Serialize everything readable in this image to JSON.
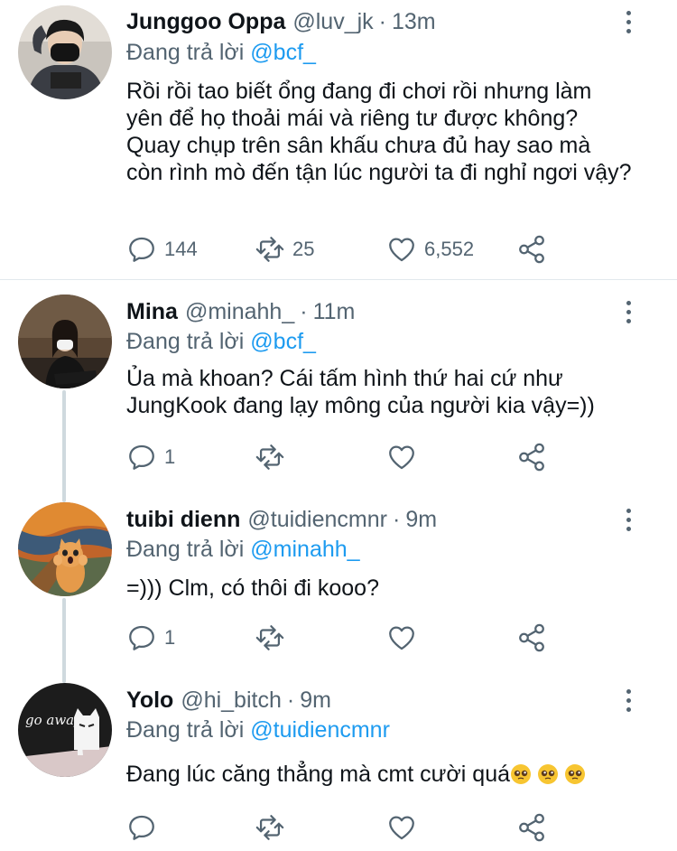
{
  "colors": {
    "text": "#0f1419",
    "secondary": "#536471",
    "link": "#1d9bf0",
    "line": "#cfd9de"
  },
  "reply_prefix": "Đang trả lời",
  "tweets": [
    {
      "name": "Junggoo Oppa",
      "handle": "@luv_jk",
      "time": "13m",
      "reply_to": "@bcf_",
      "text": "Rồi rồi tao biết ổng đang đi chơi rồi nhưng làm yên để họ thoải mái và riêng tư được không? Quay chụp trên sân khấu chưa đủ hay sao mà còn rình mò đến tận lúc người ta đi nghỉ ngơi vậy?",
      "replies": "144",
      "retweets": "25",
      "likes": "6,552"
    },
    {
      "name": "Mina",
      "handle": "@minahh_",
      "time": "11m",
      "reply_to": "@bcf_",
      "text": "Ủa mà khoan? Cái tấm hình thứ hai cứ như JungKook đang lạy mông của người kia vậy=))",
      "replies": "1",
      "retweets": "",
      "likes": ""
    },
    {
      "name": "tuibi dienn",
      "handle": "@tuidiencmnr",
      "time": "9m",
      "reply_to": "@minahh_",
      "text": "=))) Clm, có thôi đi kooo?",
      "replies": "1",
      "retweets": "",
      "likes": ""
    },
    {
      "name": "Yolo",
      "handle": "@hi_bitch",
      "time": "9m",
      "reply_to": "@tuidiencmnr",
      "text": "Đang lúc căng thẳng mà cmt cười quá",
      "avatar_text": "go away",
      "emoji_count": 3,
      "replies": "",
      "retweets": "",
      "likes": ""
    }
  ]
}
